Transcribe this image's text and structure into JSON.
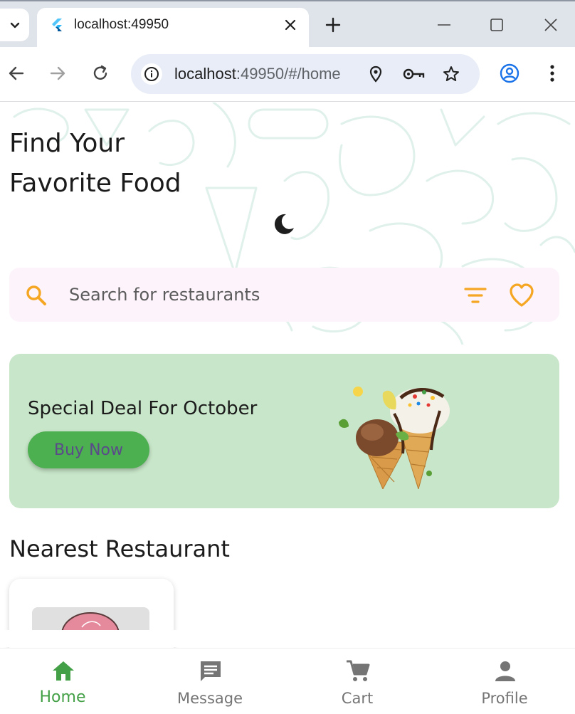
{
  "browser": {
    "tab_title": "localhost:49950",
    "url_host": "localhost",
    "url_path": ":49950/#/home"
  },
  "page": {
    "headline_line1": "Find Your",
    "headline_line2": "Favorite Food",
    "search_placeholder": "Search for restaurants"
  },
  "deal": {
    "title": "Special Deal For October",
    "button_label": "Buy Now"
  },
  "nearest": {
    "title": "Nearest Restaurant"
  },
  "bottom_nav": {
    "items": [
      {
        "label": "Home",
        "icon": "home-icon",
        "active": true
      },
      {
        "label": "Message",
        "icon": "message-icon",
        "active": false
      },
      {
        "label": "Cart",
        "icon": "cart-icon",
        "active": false
      },
      {
        "label": "Profile",
        "icon": "profile-icon",
        "active": false
      }
    ]
  },
  "colors": {
    "accent_orange": "#f5a623",
    "brand_green": "#4caf50",
    "deal_bg": "#c8e6c9",
    "search_bg": "#fdf3fb"
  }
}
